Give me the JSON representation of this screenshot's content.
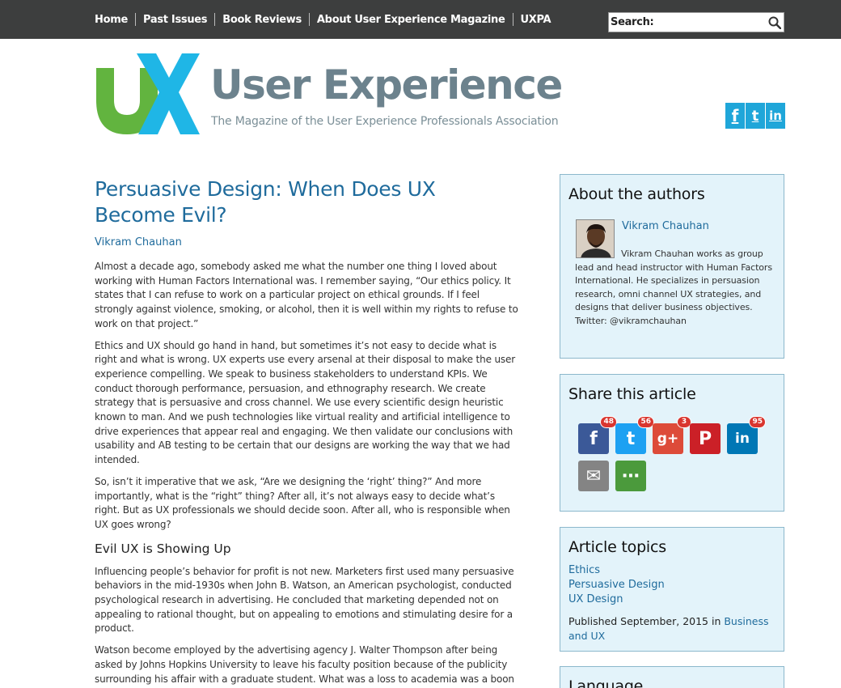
{
  "nav": {
    "items": [
      "Home",
      "Past Issues",
      "Book Reviews",
      "About User Experience Magazine",
      "UXPA"
    ],
    "search_label": "Search:"
  },
  "masthead": {
    "logo_text": "UX",
    "title": "User Experience",
    "subtitle": "The Magazine of the User Experience Professionals Association",
    "social": [
      "f",
      "t",
      "in"
    ]
  },
  "article": {
    "title": "Persuasive Design: When Does UX Become Evil?",
    "author": "Vikram Chauhan",
    "paragraphs": [
      "Almost a decade ago, somebody asked me what the number one thing I loved about working with Human Factors International was. I remember saying, “Our ethics policy. It states that I can refuse to work on a particular project on ethical grounds. If I feel strongly against violence, smoking, or alcohol, then it is well within my rights to refuse to work on that project.”",
      "Ethics and UX should go hand in hand, but sometimes it’s not easy to decide what is right and what is wrong. UX experts use every arsenal at their disposal to make the user experience compelling. We speak to business stakeholders to understand KPIs. We conduct thorough performance, persuasion, and ethnography research. We create strategy that is persuasive and cross channel. We use every scientific design heuristic known to man. And we push technologies like virtual reality and artificial intelligence to drive experiences that appear real and engaging. We then validate our conclusions with usability and AB testing to be certain that our designs are working the way that we had intended.",
      "So, isn’t it imperative that we ask, “Are we designing the ‘right’ thing?” And more importantly, what is the “right” thing? After all, it’s not always easy to decide what’s right. But as UX professionals we should decide soon. After all, who is responsible when UX goes wrong?"
    ],
    "heading": "Evil UX is Showing Up",
    "paragraphs2": [
      "Influencing people’s behavior for profit is not new. Marketers first used many persuasive behaviors in the mid-1930s when John B. Watson, an American psychologist, conducted psychological research in advertising. He concluded that marketing depended not on appealing to rational thought, but on appealing to emotions and stimulating desire for a product.",
      "Watson become employed by the advertising agency J. Walter Thompson after being asked by Johns Hopkins University to leave his faculty position because of the publicity surrounding his affair with a graduate student. What was a loss to academia was a boon"
    ]
  },
  "sidebar": {
    "authors": {
      "heading": "About the authors",
      "name": "Vikram Chauhan",
      "bio": "Vikram Chauhan works as group lead and head instructor with Human Factors International. He specializes in persuasion research, omni channel UX strategies, and designs that deliver business objectives. Twitter: @vikramchauhan"
    },
    "share": {
      "heading": "Share this article",
      "buttons": [
        {
          "name": "facebook",
          "glyph": "f",
          "count": "48",
          "color": "#3b5998"
        },
        {
          "name": "twitter",
          "glyph": "t",
          "count": "56",
          "color": "#1da1f2"
        },
        {
          "name": "google-plus",
          "glyph": "g+",
          "count": "3",
          "color": "#dd4b39"
        },
        {
          "name": "pinterest",
          "glyph": "P",
          "count": "",
          "color": "#cb2027"
        },
        {
          "name": "linkedin",
          "glyph": "in",
          "count": "95",
          "color": "#0077b5"
        },
        {
          "name": "email",
          "glyph": "✉",
          "count": "",
          "color": "#848484"
        },
        {
          "name": "more",
          "glyph": "⋯",
          "count": "",
          "color": "#4b9a3c"
        }
      ]
    },
    "topics": {
      "heading": "Article topics",
      "items": [
        "Ethics",
        "Persuasive Design",
        "UX Design"
      ],
      "published_prefix": "Published September, 2015 in ",
      "published_link": "Business and UX"
    },
    "language": {
      "heading": "Language"
    }
  }
}
